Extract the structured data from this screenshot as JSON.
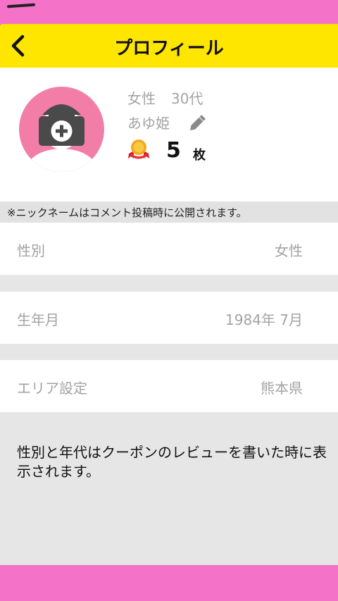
{
  "header": {
    "title": "プロフィール"
  },
  "profile": {
    "gender": "女性",
    "age": "30代",
    "nickname": "あゆ姫",
    "coupon_count": "5",
    "coupon_unit": "枚"
  },
  "notice": "※ニックネームはコメント投稿時に公開されます。",
  "fields": {
    "gender": {
      "label": "性別",
      "value": "女性"
    },
    "birth": {
      "label": "生年月",
      "value": "1984年 7月"
    },
    "area": {
      "label": "エリア設定",
      "value": "熊本県"
    }
  },
  "footer_note": "性別と年代はクーポンのレビューを書いた時に表示されます。",
  "colors": {
    "header_bg": "#ffe600",
    "accent_pink": "#f472c8",
    "avatar_bg": "#f27ea8",
    "muted_text": "#a3a3a3"
  },
  "icons": {
    "back": "chevron-left-icon",
    "avatar": "camera-plus-icon",
    "edit": "pencil-icon",
    "medal": "medal-icon"
  }
}
